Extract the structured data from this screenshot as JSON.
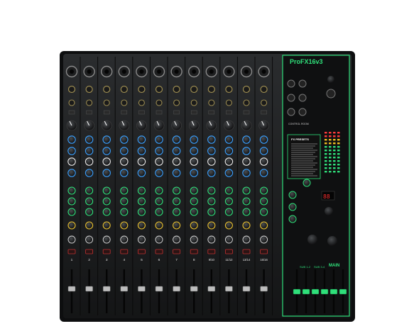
{
  "product": {
    "brand_logo": "ProFX16v3",
    "accent_color": "#2fe07a",
    "body_color": "#1b1d1f"
  },
  "channel_strips": {
    "bottom_labels": [
      "1",
      "2",
      "3",
      "4",
      "5",
      "6",
      "7",
      "8",
      "9/10",
      "11/12",
      "13/14",
      "15/16"
    ]
  },
  "master_section": {
    "panel_title": "FX PRESETS",
    "fx_display_value": "88",
    "bus_labels": [
      "SUB 1-2",
      "SUB 3-4",
      "MAIN"
    ],
    "control_room_label": "CONTROL ROOM"
  }
}
